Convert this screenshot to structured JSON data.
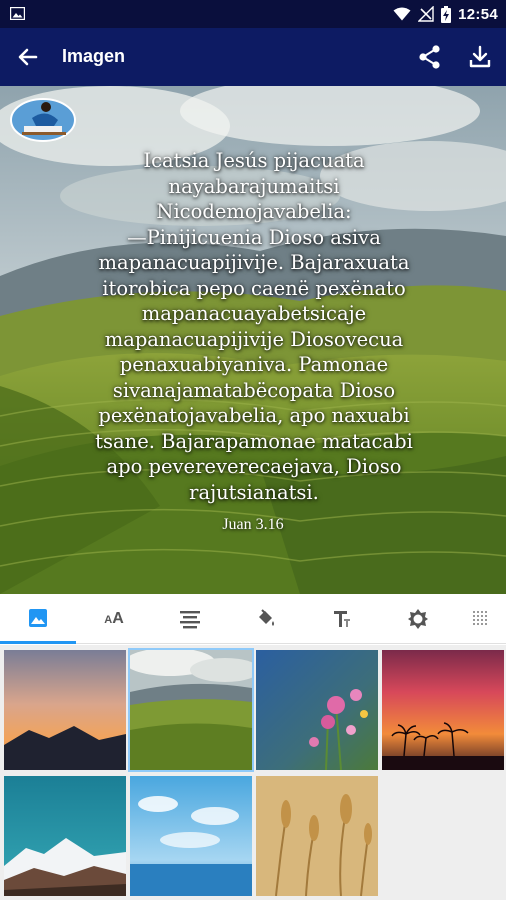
{
  "status_bar": {
    "time": "12:54"
  },
  "app_bar": {
    "title": "Imagen",
    "back_icon": "arrow-left-icon",
    "share_icon": "share-icon",
    "download_icon": "download-icon"
  },
  "verse": {
    "lines": [
      "Icatsia Jesús pijacuata",
      "nayabarajumaitsi",
      "Nicodemojavabelia:",
      "—Pinijicuenia Dioso asiva",
      "mapanacuapijivije. Bajaraxuata",
      "itorobica pepo caenë pexënato",
      "mapanacuayabetsicaje",
      "mapanacuapijivije Diosovecua",
      "penaxuabiyaniva. Pamonae",
      "sivanajamatabëcopata Dioso",
      "pexënatojavabelia, apo naxuabi",
      "tsane. Bajarapamonae matacabi",
      "apo pevereverecaejava, Dioso",
      "rajutsianatsi."
    ],
    "reference": "Juan 3.16"
  },
  "tool_tabs": [
    {
      "name": "background-image",
      "icon": "image-icon",
      "active": true
    },
    {
      "name": "font-size",
      "icon": "font-size-icon",
      "active": false
    },
    {
      "name": "text-align",
      "icon": "align-center-icon",
      "active": false
    },
    {
      "name": "color-fill",
      "icon": "paint-bucket-icon",
      "active": false
    },
    {
      "name": "font-style",
      "icon": "text-format-icon",
      "active": false
    },
    {
      "name": "brightness",
      "icon": "brightness-icon",
      "active": false
    },
    {
      "name": "texture",
      "icon": "grid-dots-icon",
      "active": false
    }
  ],
  "thumbnails": [
    {
      "name": "sunset-mountains",
      "selected": false
    },
    {
      "name": "green-hills",
      "selected": true
    },
    {
      "name": "pink-flowers",
      "selected": false
    },
    {
      "name": "palm-sunset",
      "selected": false
    },
    {
      "name": "snowy-mountain",
      "selected": false
    },
    {
      "name": "sky-sea",
      "selected": false
    },
    {
      "name": "wheat-field",
      "selected": false
    }
  ],
  "colors": {
    "status_bar": "#0a0f3d",
    "app_bar": "#0d1b63",
    "tab_indicator": "#2196f3",
    "selected_thumb_border": "#90caf9"
  }
}
